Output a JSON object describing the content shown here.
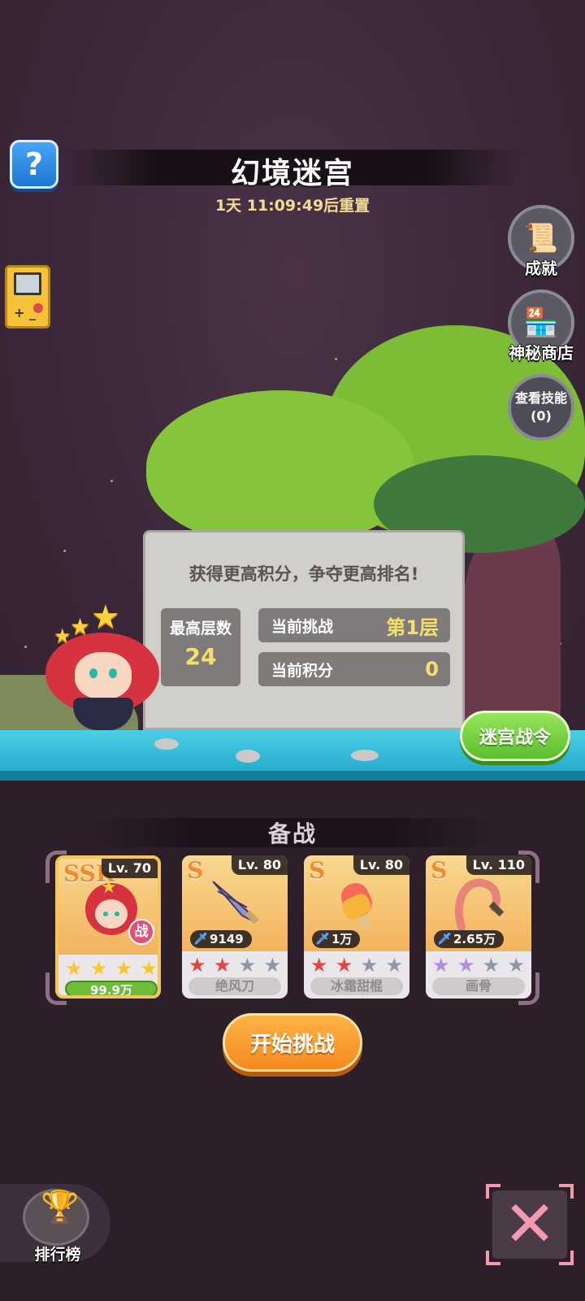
{
  "header": {
    "title": "幻境迷宫",
    "reset_countdown": "1天 11:09:49后重置"
  },
  "side_menu": {
    "achievements_label": "成就",
    "mystery_shop_label": "神秘商店",
    "view_skills_label": "查看技能",
    "view_skills_count": "(0)"
  },
  "stone": {
    "slogan": "获得更高积分，争夺更高排名!",
    "best_floor_label": "最高层数",
    "best_floor_value": "24",
    "current_challenge_label": "当前挑战",
    "current_challenge_value": "第1层",
    "current_score_label": "当前积分",
    "current_score_value": "0"
  },
  "battle_pass_label": "迷宫战令",
  "prep": {
    "title": "备战",
    "cards": [
      {
        "rank": "SSR",
        "level": "Lv. 70",
        "stars_filled": 4,
        "stars_total": 4,
        "hp": "99.9万",
        "badge": "战"
      },
      {
        "rank": "S",
        "level": "Lv. 80",
        "power": "9149",
        "stars_filled": 2,
        "stars_total": 4,
        "name": "绝风刀",
        "star_color": "#e0464a"
      },
      {
        "rank": "S",
        "level": "Lv. 80",
        "power": "1万",
        "stars_filled": 2,
        "stars_total": 4,
        "name": "冰霜甜棍",
        "star_color": "#e0464a"
      },
      {
        "rank": "S",
        "level": "Lv. 110",
        "power": "2.65万",
        "stars_filled": 2,
        "stars_total": 4,
        "name": "画骨",
        "star_color": "#b48be0"
      }
    ]
  },
  "start_button_label": "开始挑战",
  "ranking_label": "排行榜",
  "icons": {
    "help": "question-icon",
    "gameboy": "gameboy-icon",
    "achievements": "scroll-icon",
    "shop": "shop-icon",
    "ranking": "trophy-icon",
    "close": "close-icon"
  },
  "colors": {
    "background": "#3a2739",
    "accent_orange": "#f58a1e",
    "accent_green": "#5cbd2f",
    "gold_text": "#f6de6a"
  }
}
